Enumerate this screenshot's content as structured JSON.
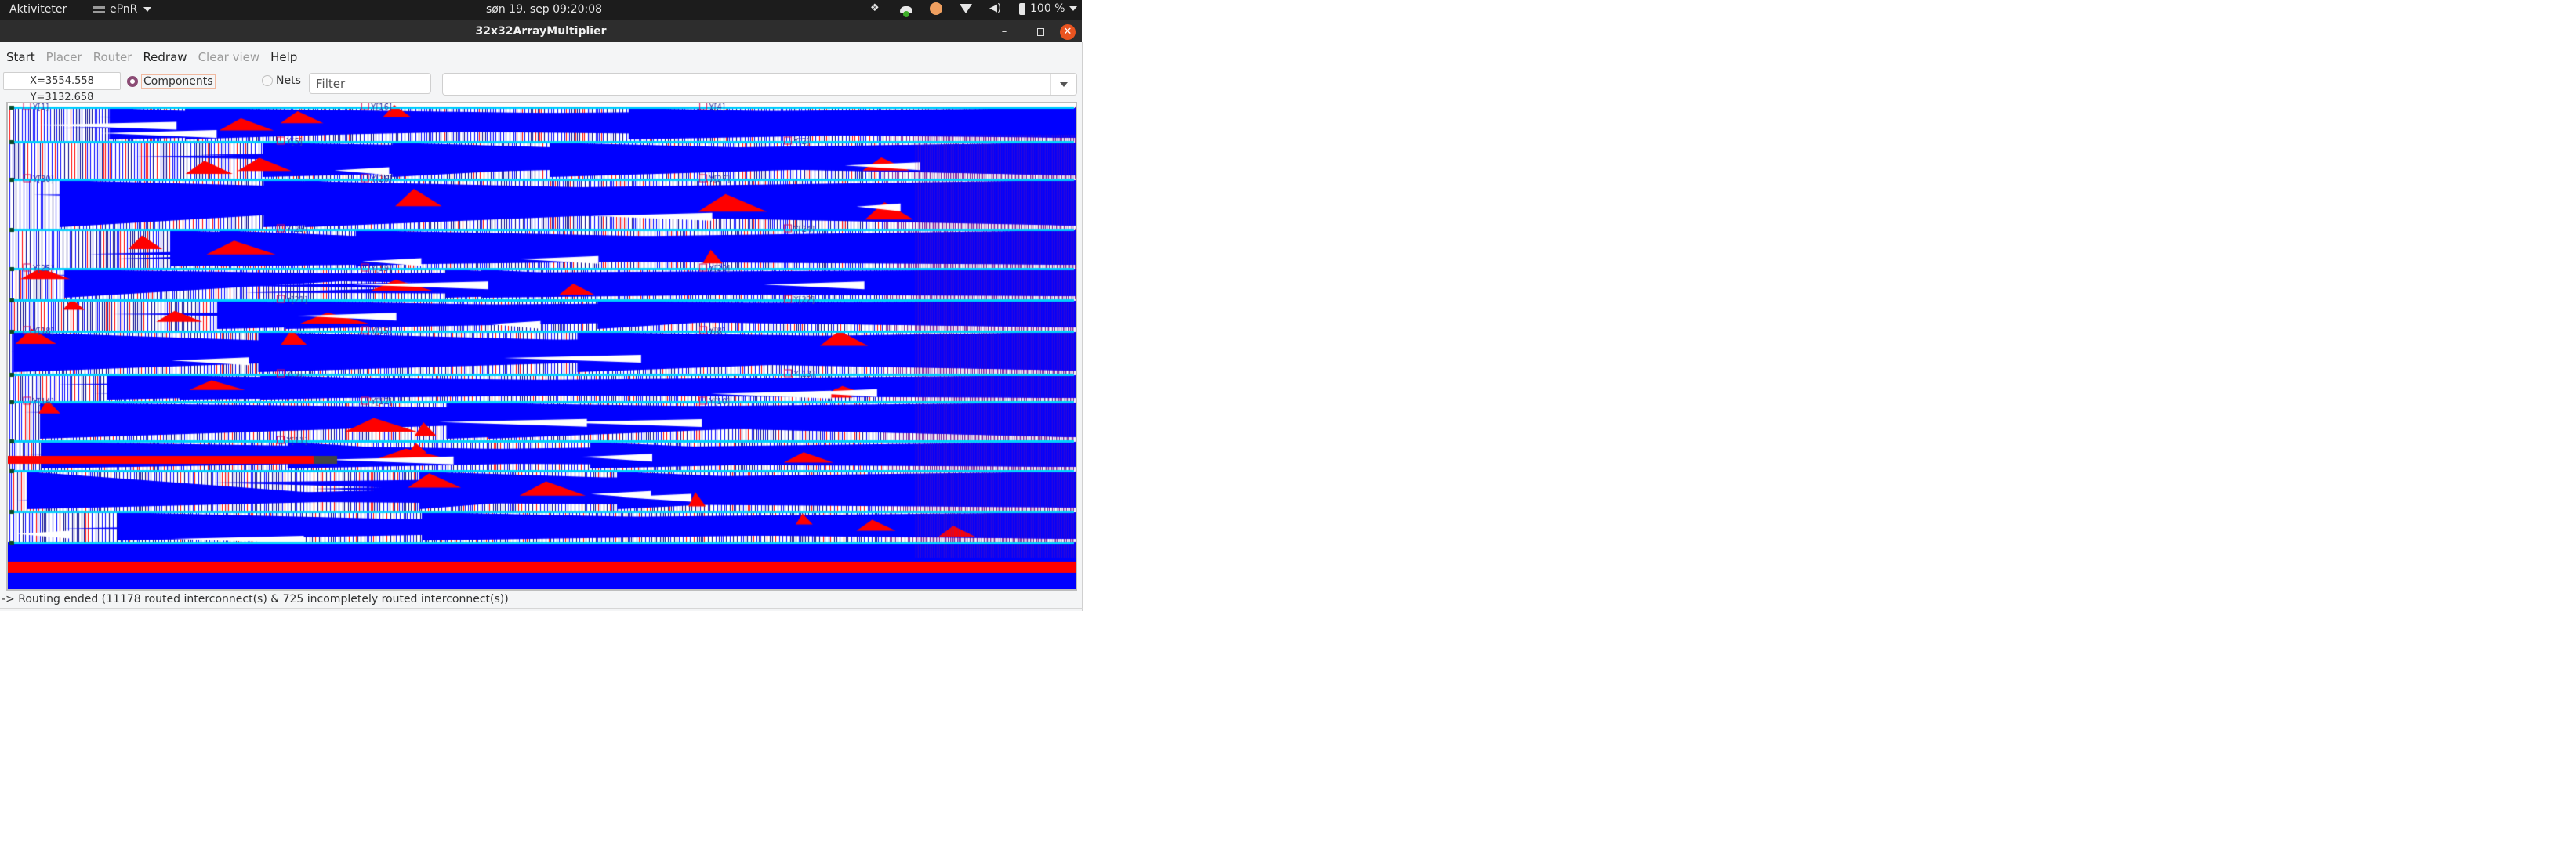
{
  "topbar": {
    "activities": "Aktiviteter",
    "app_name": "ePnR",
    "clock": "søn 19. sep  09:20:08",
    "battery": "100 %",
    "tray_icons": [
      "dropbox-icon",
      "cloud-sync-icon",
      "app-indicator-icon",
      "wifi-icon",
      "volume-icon",
      "battery-icon"
    ]
  },
  "window": {
    "title": "32x32ArrayMultiplier",
    "controls": {
      "minimize": "–",
      "maximize": "restore-icon",
      "close": "✕"
    }
  },
  "menu": [
    {
      "label": "Start",
      "enabled": true
    },
    {
      "label": "Placer",
      "enabled": false
    },
    {
      "label": "Router",
      "enabled": false
    },
    {
      "label": "Redraw",
      "enabled": true
    },
    {
      "label": "Clear view",
      "enabled": false
    },
    {
      "label": "Help",
      "enabled": true
    }
  ],
  "toolbar": {
    "coordinates": "X=3554.558 Y=3132.658",
    "mode_components": "Components",
    "mode_nets": "Nets",
    "selected_mode": "Components",
    "filter_placeholder": "Filter",
    "selection_value": ""
  },
  "canvas": {
    "component_labels": [
      "Y[1]",
      "Y[16]",
      "Y[4]",
      "Y[5]",
      "Y[2]",
      "Y[30]",
      "Y[26]",
      "Y[27]",
      "Y[23]",
      "Y[24]",
      "Y[25]",
      "Y[19]",
      "Y[20]",
      "Y[21]",
      "Y[22]",
      "Y[18]",
      "Y[15]",
      "Y[8]",
      "Y[9]",
      "Y[13]",
      "Y[14]",
      "Y[12]",
      "Y[10]",
      "Y[11]"
    ],
    "colors": {
      "routed": "#0000ff",
      "incomplete": "#ff0000",
      "rail": "#00d0ff",
      "dense": "#7a1a9a",
      "dark": "#00008b"
    }
  },
  "status": {
    "message": "-> Routing ended (11178 routed interconnect(s) & 725 incompletely routed interconnect(s))",
    "routed": 11178,
    "incomplete": 725
  }
}
